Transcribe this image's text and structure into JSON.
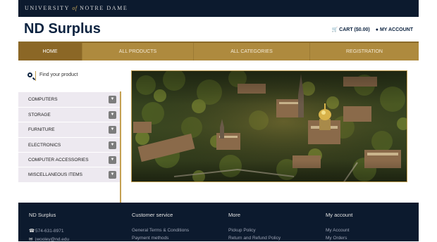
{
  "topbar": {
    "university_pre": "UNIVERSITY",
    "university_of": "of",
    "university_post": "NOTRE DAME"
  },
  "header": {
    "title": "ND Surplus",
    "cart_label": "CART ($0.00)",
    "account_label": "MY ACCOUNT"
  },
  "nav": {
    "items": [
      {
        "label": "HOME"
      },
      {
        "label": "ALL PRODUCTS"
      },
      {
        "label": "ALL CATEGORIES"
      },
      {
        "label": "REGISTRATION"
      }
    ]
  },
  "search": {
    "placeholder": "Find your product"
  },
  "categories": [
    {
      "label": "COMPUTERS"
    },
    {
      "label": "STORAGE"
    },
    {
      "label": "FURNITURE"
    },
    {
      "label": "ELECTRONICS"
    },
    {
      "label": "COMPUTER ACCESSORIES"
    },
    {
      "label": "MISCELLANEOUS ITEMS"
    }
  ],
  "footer": {
    "col1": {
      "title": "ND Surplus",
      "phone": "574-631-8971",
      "email": "jwooley@nd.edu"
    },
    "col2": {
      "title": "Customer service",
      "links": [
        "General Terms & Conditions",
        "Payment methods"
      ]
    },
    "col3": {
      "title": "More",
      "links": [
        "Pickup Policy",
        "Return and Refund Policy"
      ]
    },
    "col4": {
      "title": "My account",
      "links": [
        "My Account",
        "My Orders"
      ]
    }
  },
  "icons": {
    "search": "search-icon",
    "cart": "cart-icon",
    "user": "user-icon",
    "chevron": "chevron-down-icon",
    "phone": "phone-icon",
    "email": "email-icon"
  },
  "colors": {
    "navy": "#0c1a2e",
    "gold": "#ae8a3e",
    "gold_dark": "#8b6726",
    "category_bg": "#ede9f0"
  }
}
